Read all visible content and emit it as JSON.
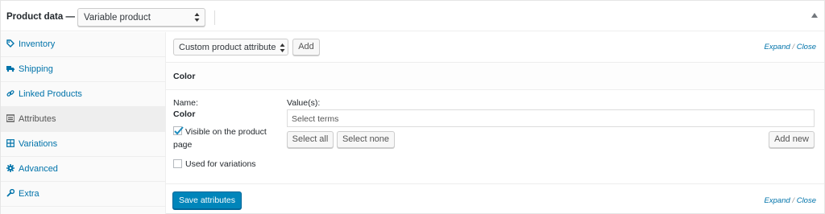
{
  "header": {
    "title": "Product data —",
    "product_type": "Variable product",
    "collapse_icon": "triangle-up-icon"
  },
  "sidebar": {
    "items": [
      {
        "label": "Inventory",
        "icon": "tag-icon",
        "active": false
      },
      {
        "label": "Shipping",
        "icon": "truck-icon",
        "active": false
      },
      {
        "label": "Linked Products",
        "icon": "link-icon",
        "active": false
      },
      {
        "label": "Attributes",
        "icon": "list-icon",
        "active": true
      },
      {
        "label": "Variations",
        "icon": "grid-icon",
        "active": false
      },
      {
        "label": "Advanced",
        "icon": "gear-icon",
        "active": false
      },
      {
        "label": "Extra",
        "icon": "wrench-icon",
        "active": false
      }
    ]
  },
  "toolbar": {
    "attribute_select": "Custom product attribute",
    "add_label": "Add",
    "expand": "Expand",
    "slash": "/",
    "close": "Close"
  },
  "attribute": {
    "header_title": "Color",
    "name_label": "Name:",
    "name_value": "Color",
    "values_label": "Value(s):",
    "values_placeholder": "Select terms",
    "visible_label_1": "Visible on the product",
    "visible_label_2": "page",
    "visible_checked": true,
    "variations_label": "Used for variations",
    "variations_checked": false,
    "select_all": "Select all",
    "select_none": "Select none",
    "add_new": "Add new"
  },
  "footer": {
    "save_label": "Save attributes",
    "expand": "Expand",
    "slash": "/",
    "close": "Close"
  },
  "colors": {
    "link": "#0073aa",
    "primary_button": "#0085ba",
    "active_tab_bg": "#eeeeee"
  }
}
